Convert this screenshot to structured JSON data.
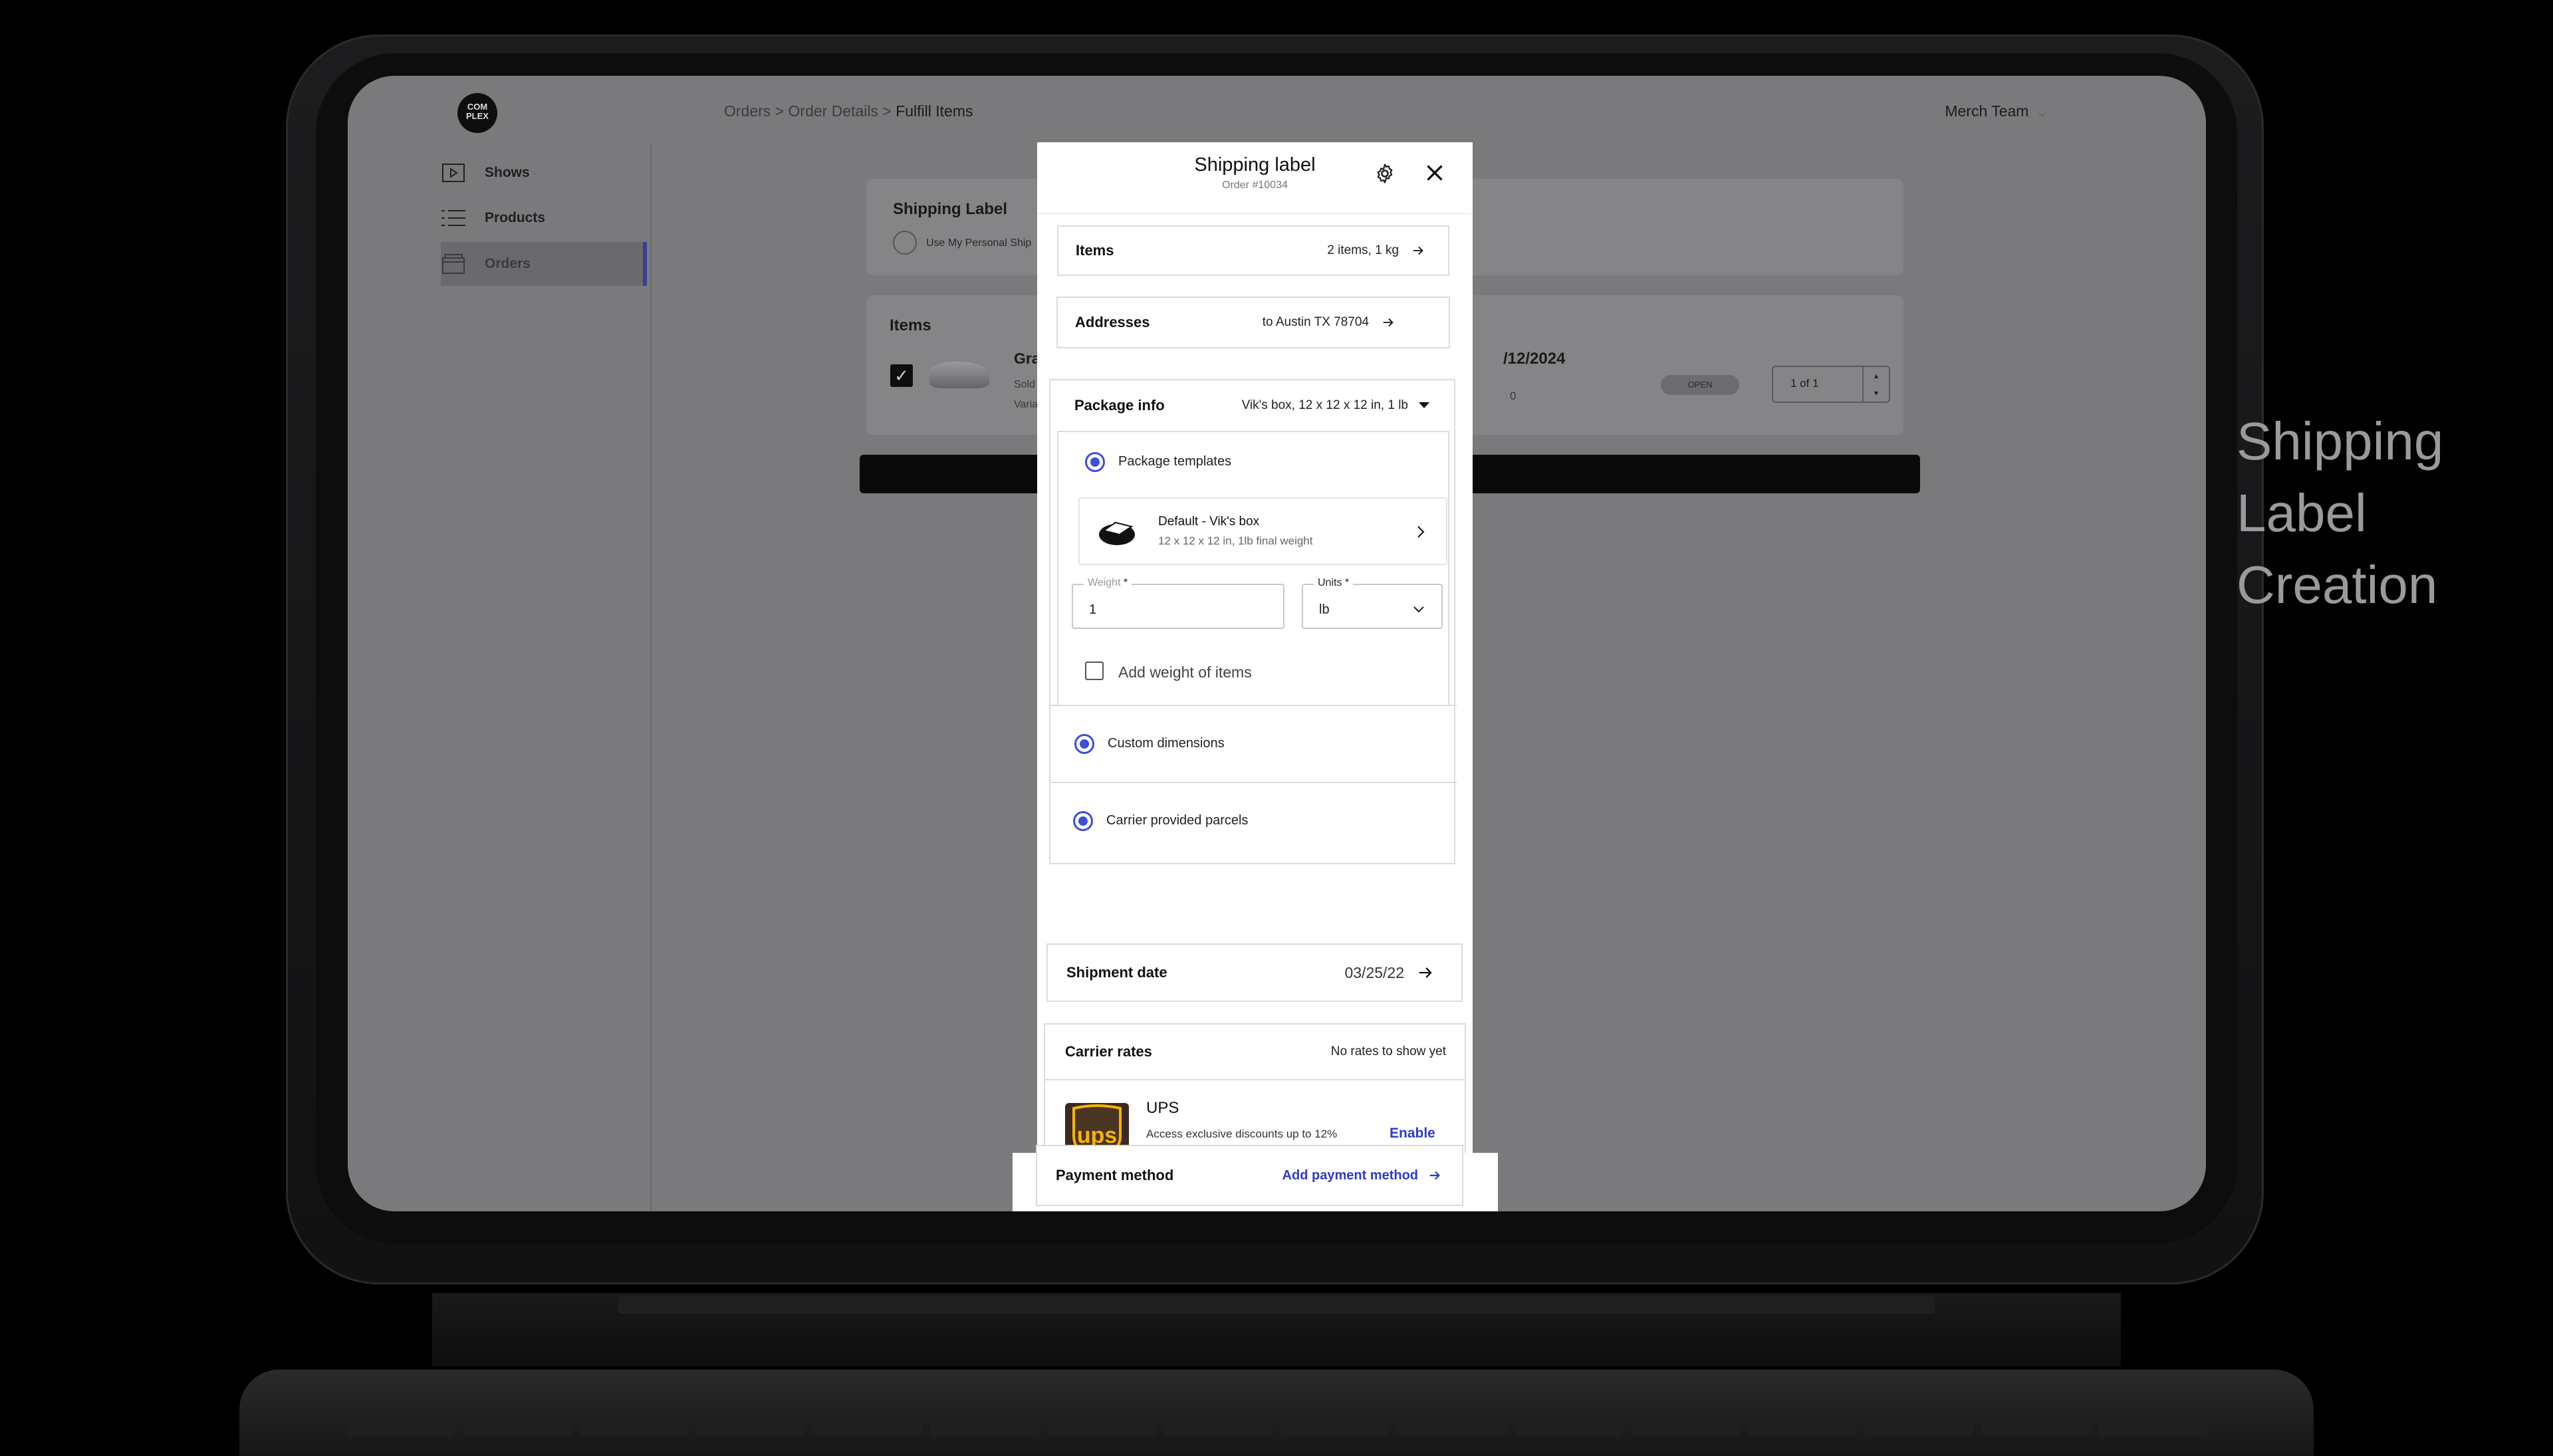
{
  "caption": {
    "line1": "Shipping",
    "line2": "Label",
    "line3": "Creation"
  },
  "app": {
    "logo_text": "COM PLEX",
    "breadcrumb": {
      "part1": "Orders",
      "sep1": " > ",
      "part2": "Order Details",
      "sep2": " > ",
      "current": "Fulfill Items"
    },
    "team": "Merch Team",
    "team_caret": "⌵"
  },
  "sidebar": {
    "items": [
      {
        "label": "Shows",
        "icon": "play-icon"
      },
      {
        "label": "Products",
        "icon": "list-icon"
      },
      {
        "label": "Orders",
        "icon": "box-icon",
        "active": true
      }
    ]
  },
  "background_cards": {
    "shipping_label": {
      "title": "Shipping Label",
      "option": "Use My Personal Ship"
    },
    "items": {
      "title": "Items",
      "product_name": "Gray &",
      "product_sub1": "Sold for",
      "product_sub2": "Variant:",
      "date": "/12/2024",
      "zero": "0",
      "badge": "OPEN",
      "pager": "1 of 1",
      "spin_up": "▴",
      "spin_down": "▾",
      "check": "✓"
    }
  },
  "modal": {
    "title": "Shipping label",
    "order": "Order #10034",
    "items_row": {
      "label": "Items",
      "value": "2 items, 1 kg"
    },
    "addresses_row": {
      "label": "Addresses",
      "value": "to Austin TX 78704"
    },
    "package": {
      "label": "Package info",
      "value": "Vik's box, 12 x 12 x 12 in, 1 lb",
      "templates_label": "Package templates",
      "template_name": "Default - Vik's box",
      "template_desc": "12 x 12 x 12 in, 1lb final weight",
      "weight_label": "Weight",
      "required_mark": "*",
      "weight_value": "1",
      "units_label": "Units",
      "units_value": "lb",
      "add_weight_label": "Add weight of items",
      "custom_label": "Custom dimensions",
      "carrier_label": "Carrier provided parcels"
    },
    "shipment": {
      "label": "Shipment date",
      "value": "03/25/22"
    },
    "rates": {
      "label": "Carrier rates",
      "value": "No rates to show yet",
      "carrier_name": "UPS",
      "carrier_logo_text": "ups",
      "carrier_desc": "Access exclusive discounts up to 12%",
      "action": "Enable"
    },
    "payment": {
      "label": "Payment method",
      "action": "Add payment method"
    }
  },
  "colors": {
    "accent": "#3d4fd8",
    "link": "#2d3cc9",
    "ups_gold": "#f5b400",
    "ups_brown": "#3a2a1f"
  }
}
